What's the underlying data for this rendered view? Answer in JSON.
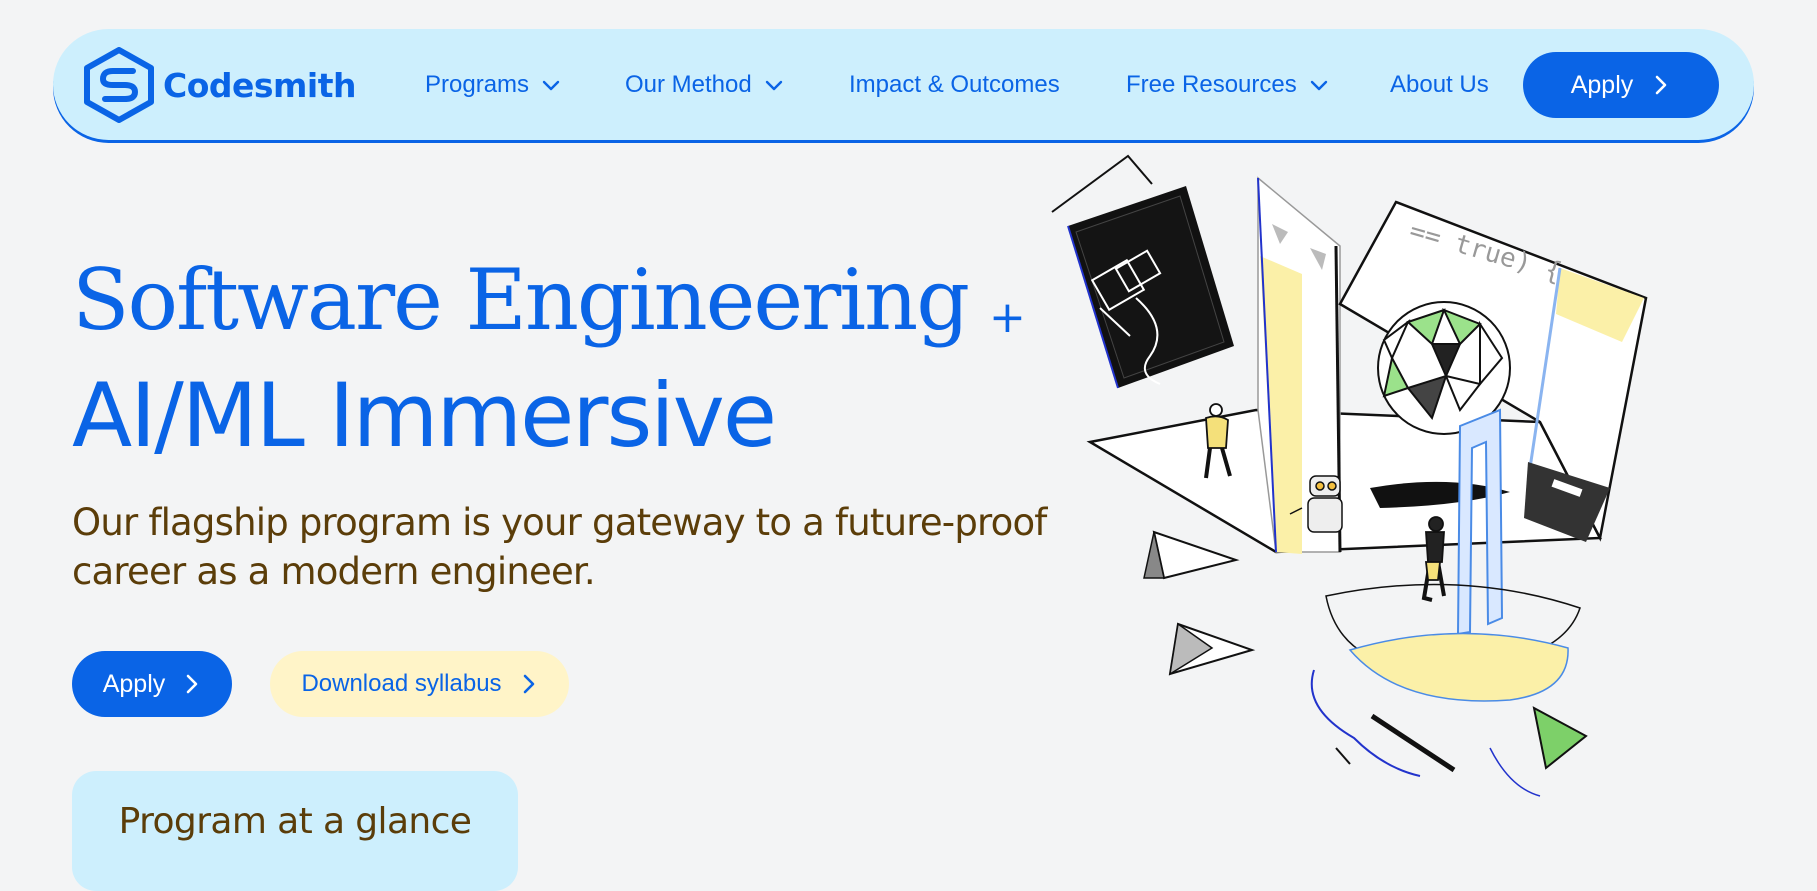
{
  "brand": {
    "name": "Codesmith",
    "color": "#0a64e6"
  },
  "nav": {
    "items": [
      {
        "label": "Programs",
        "has_dropdown": true
      },
      {
        "label": "Our Method",
        "has_dropdown": true
      },
      {
        "label": "Impact & Outcomes",
        "has_dropdown": false
      },
      {
        "label": "Free Resources",
        "has_dropdown": true
      },
      {
        "label": "About Us",
        "has_dropdown": false
      }
    ],
    "apply_label": "Apply"
  },
  "hero": {
    "title_line1": "Software Engineering",
    "title_plus": "+",
    "title_line2": "AI/ML Immersive",
    "subtitle": "Our flagship program is your gateway to a future-proof career as a modern engineer.",
    "apply_label": "Apply",
    "syllabus_label": "Download syllabus",
    "illustration_code_text": "== true) {"
  },
  "glance": {
    "title": "Program at a glance"
  },
  "icons": {
    "dropdown": "chevron-down-icon",
    "arrow": "chevron-right-icon"
  },
  "colors": {
    "accent": "#0a64e6",
    "nav_bg": "#cdeffd",
    "text_brown": "#5b3d09",
    "syllabus_bg": "#fff4c8",
    "page_bg": "#f3f4f5"
  }
}
